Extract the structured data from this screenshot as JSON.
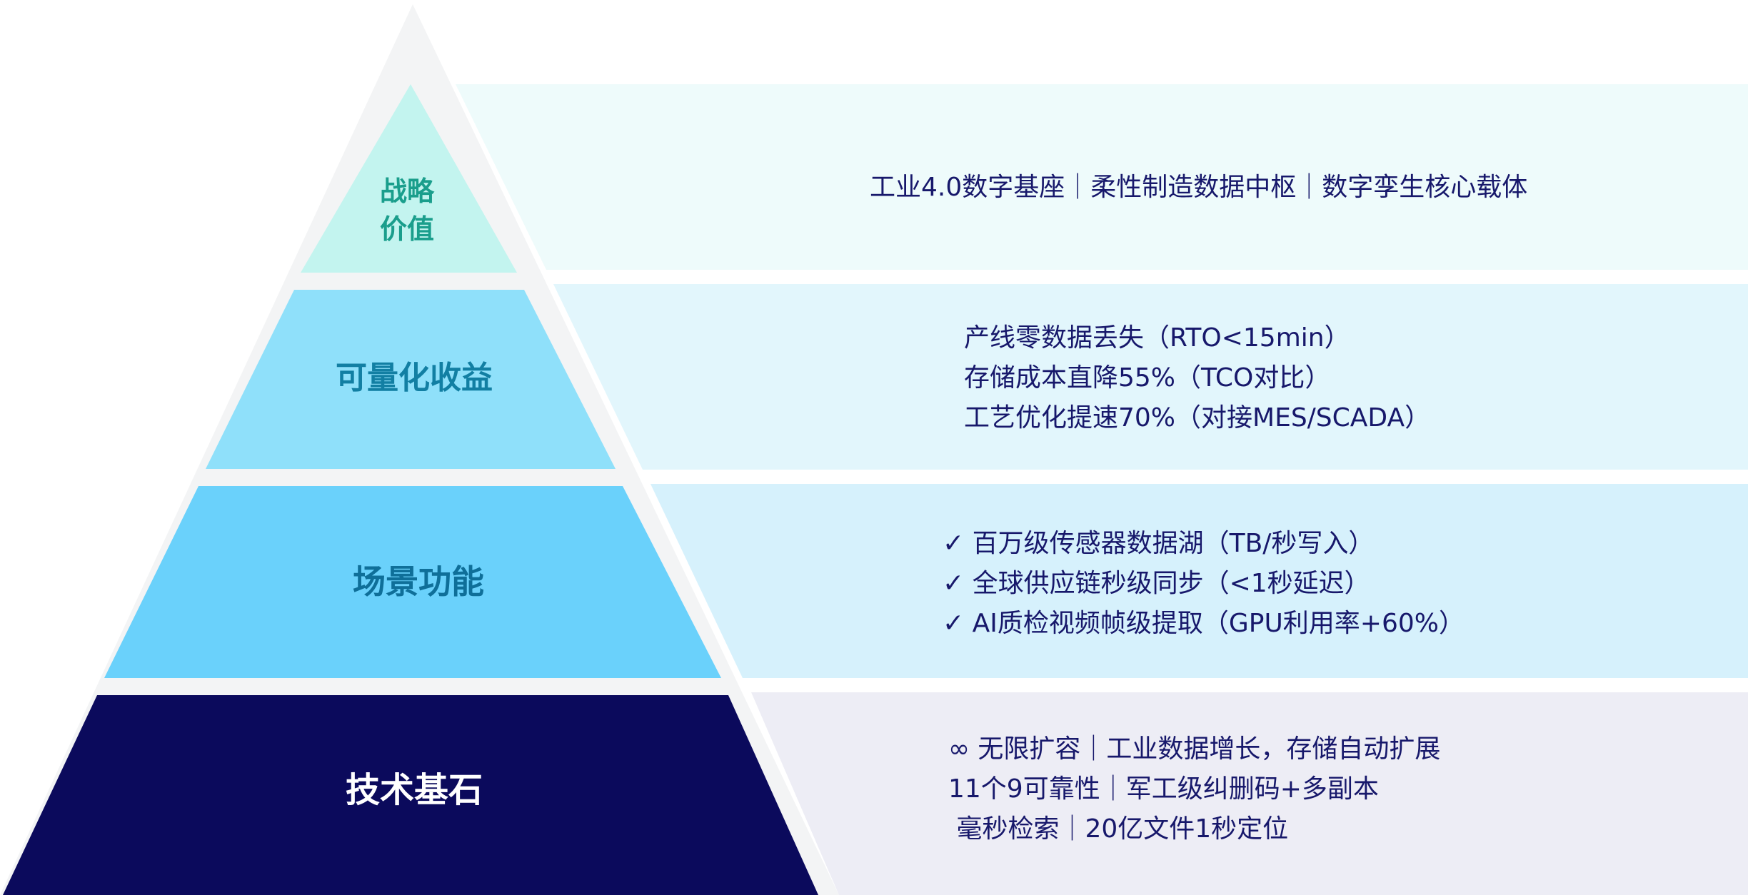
{
  "tiers": [
    {
      "label": "战略\n价值",
      "lines": [
        "工业4.0数字基座｜柔性制造数据中枢｜数字孪生核心载体"
      ]
    },
    {
      "label": "可量化收益",
      "lines": [
        "产线零数据丢失（RTO<15min）",
        "存储成本直降55%（TCO对比）",
        "工艺优化提速70%（对接MES/SCADA）"
      ]
    },
    {
      "label": "场景功能",
      "lines": [
        "✓ 百万级传感器数据湖（TB/秒写入）",
        "✓ 全球供应链秒级同步（<1秒延迟）",
        "✓ AI质检视频帧级提取（GPU利用率+60%）"
      ]
    },
    {
      "label": "技术基石",
      "lines": [
        "∞ 无限扩容｜工业数据增长，存储自动扩展",
        "11个9可靠性｜军工级纠删码+多副本",
        " 毫秒检索｜20亿文件1秒定位"
      ]
    }
  ],
  "colors": {
    "tier1_fill": "#c3f4ef",
    "tier1_band": "#eefbfb",
    "tier1_text": "#1a9e8c",
    "tier2_fill": "#8fe0fa",
    "tier2_band": "#e2f6fc",
    "tier2_text": "#127fa3",
    "tier3_fill": "#6ad1fb",
    "tier3_band": "#d6f1fc",
    "tier3_text": "#0f6f99",
    "tier4_fill": "#0b0a5c",
    "tier4_band": "#ededf5",
    "tier4_text": "#ffffff",
    "desc_text": "#17186b",
    "outline": "#f3f4f5"
  }
}
